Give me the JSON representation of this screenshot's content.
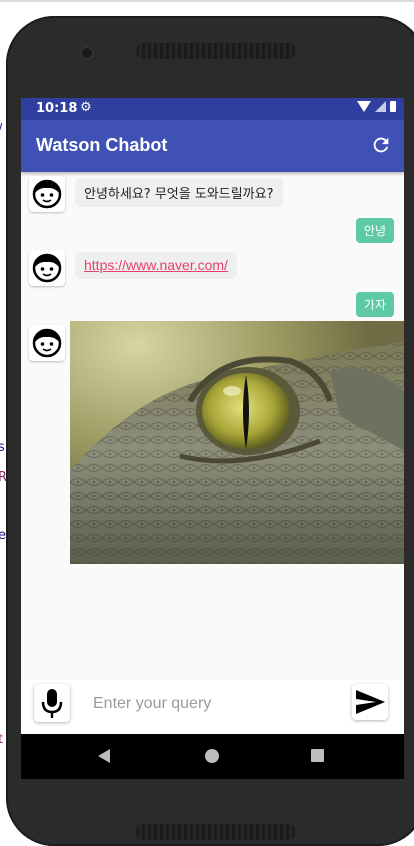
{
  "status_bar": {
    "time": "10:18"
  },
  "app_bar": {
    "title": "Watson Chabot"
  },
  "messages": [
    {
      "from": "bot",
      "text": "안녕하세요? 무엇을 도와드릴까요?"
    },
    {
      "from": "user",
      "text": "안녕"
    },
    {
      "from": "bot",
      "link": "https://www.naver.com/"
    },
    {
      "from": "user",
      "text": "가자"
    },
    {
      "from": "bot",
      "image": "crocodile-eye-photo"
    }
  ],
  "input": {
    "placeholder": "Enter your query",
    "value": ""
  },
  "icons": {
    "settings": "gear-icon",
    "refresh": "refresh-icon",
    "avatar": "face-avatar-icon",
    "mic": "microphone-icon",
    "send": "send-icon",
    "nav": [
      "back-icon",
      "home-icon",
      "recents-icon"
    ]
  },
  "colors": {
    "status_bar": "#303f9f",
    "app_bar": "#3f51b5",
    "user_bubble": "#5ec9a6",
    "link": "#e8416b",
    "bot_bubble": "#efefef"
  }
}
